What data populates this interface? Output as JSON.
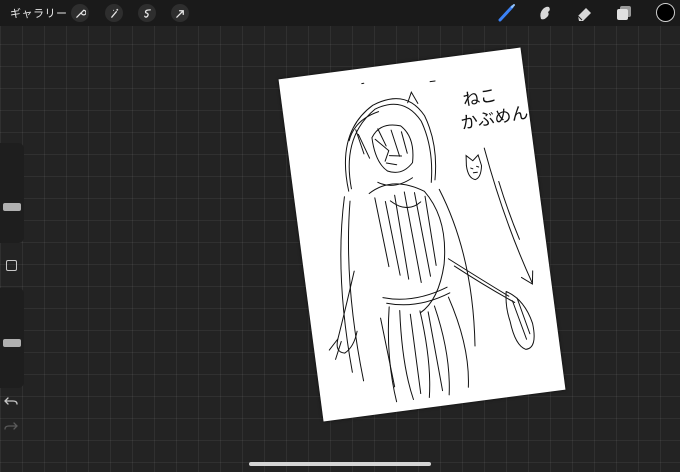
{
  "toolbar": {
    "gallery_label": "ギャラリー",
    "left_tools": [
      "wrench-icon",
      "magic-wand-icon",
      "selection-icon",
      "transform-icon"
    ],
    "right_tools": [
      "brush-icon",
      "smudge-icon",
      "eraser-icon",
      "layers-icon"
    ],
    "active_tool": "brush-icon",
    "current_color": "#000000",
    "accent_color": "#3b82f6"
  },
  "sidebar": {
    "brush_size_level": 0.35,
    "opacity_level": 0.45
  },
  "canvas": {
    "note_line_1": "ねこ",
    "note_line_2": "かぶめん"
  }
}
